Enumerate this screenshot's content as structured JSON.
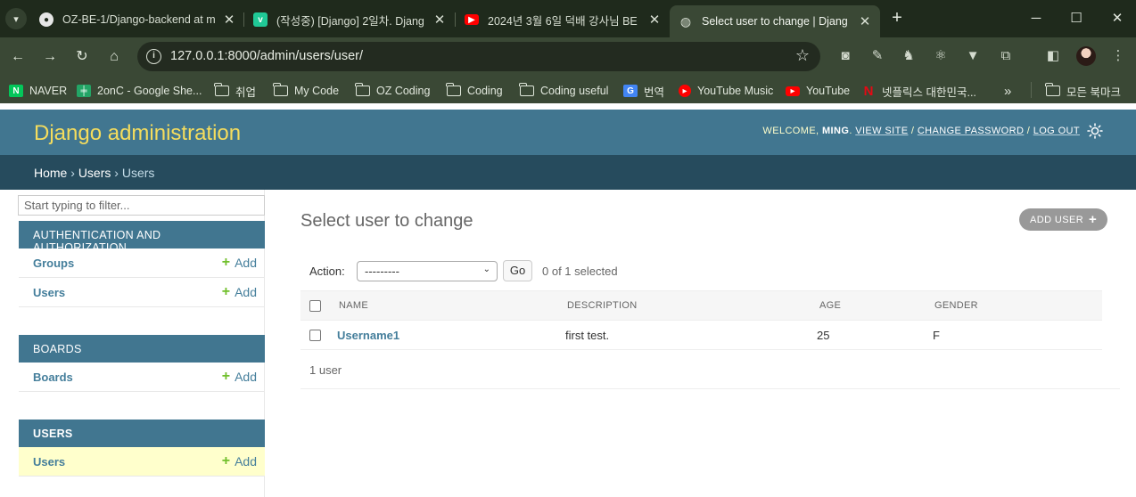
{
  "browser": {
    "tabs": [
      {
        "title": "OZ-BE-1/Django-backend at m",
        "favicon": "github-icon"
      },
      {
        "title": "(작성중) [Django] 2일차. Djang",
        "favicon": "velog-icon"
      },
      {
        "title": "2024년 3월 6일 덕배 강사님 BE",
        "favicon": "youtube-icon"
      },
      {
        "title": "Select user to change | Djang",
        "favicon": "globe-icon",
        "active": true
      }
    ],
    "url": "127.0.0.1:8000/admin/users/user/",
    "bookmarks": [
      {
        "label": "NAVER",
        "icon": "naver-icon"
      },
      {
        "label": "2onC - Google She...",
        "icon": "sheets-icon"
      },
      {
        "label": "취업",
        "icon": "folder-icon"
      },
      {
        "label": "My Code",
        "icon": "folder-icon"
      },
      {
        "label": "OZ Coding",
        "icon": "folder-icon"
      },
      {
        "label": "Coding",
        "icon": "folder-icon"
      },
      {
        "label": "Coding useful",
        "icon": "folder-icon"
      },
      {
        "label": "번역",
        "icon": "translate-icon"
      },
      {
        "label": "YouTube Music",
        "icon": "youtube-music-icon"
      },
      {
        "label": "YouTube",
        "icon": "youtube-icon"
      },
      {
        "label": "넷플릭스 대한민국...",
        "icon": "netflix-icon"
      }
    ],
    "all_bookmarks": "모든 북마크"
  },
  "admin": {
    "brand": "Django administration",
    "usertools": {
      "welcome": "WELCOME,",
      "username": "MING",
      "view_site": "VIEW SITE",
      "change_password": "CHANGE PASSWORD",
      "log_out": "LOG OUT"
    },
    "breadcrumbs": [
      "Home",
      "Users",
      "Users"
    ],
    "filter_placeholder": "Start typing to filter...",
    "add_label": "Add",
    "modules": [
      {
        "caption": "AUTHENTICATION AND AUTHORIZATION",
        "models": [
          "Groups",
          "Users"
        ]
      },
      {
        "caption": "BOARDS",
        "models": [
          "Boards"
        ]
      },
      {
        "caption": "USERS",
        "models": [
          "Users"
        ],
        "current": true
      }
    ],
    "page_title": "Select user to change",
    "add_user": "ADD USER",
    "action_label": "Action:",
    "action_value": "---------",
    "go": "Go",
    "selected": "0 of 1 selected",
    "columns": [
      "NAME",
      "DESCRIPTION",
      "AGE",
      "GENDER"
    ],
    "rows": [
      {
        "name": "Username1",
        "description": "first test.",
        "age": "25",
        "gender": "F"
      }
    ],
    "paginator": "1 user"
  },
  "colors": {
    "header": "#417690",
    "breadcrumbs": "#264b5d",
    "brand": "#f5dd5d",
    "link": "#447e9b",
    "add_plus": "#70bf2b",
    "current_row": "#ffffcc"
  }
}
